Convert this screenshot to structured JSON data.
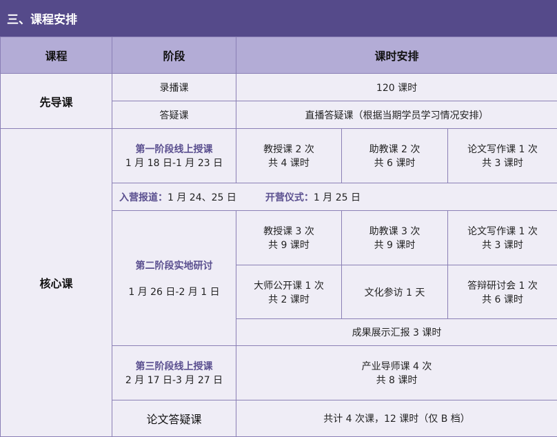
{
  "section_title": "三、课程安排",
  "headers": {
    "course": "课程",
    "stage": "阶段",
    "schedule": "课时安排"
  },
  "guide": {
    "course": "先导课",
    "rows": [
      {
        "stage": "录播课",
        "schedule": "120 课时"
      },
      {
        "stage": "答疑课",
        "schedule": "直播答疑课（根据当期学员学习情况安排）"
      }
    ]
  },
  "core": {
    "course": "核心课",
    "phase1": {
      "name": "第一阶段线上授课",
      "dates": "1 月 18 日-1 月 23 日",
      "cells": [
        {
          "line1": "教授课 2 次",
          "line2": "共 4 课时"
        },
        {
          "line1": "助教课  2 次",
          "line2": "共 6 课时"
        },
        {
          "line1": "论文写作课  1 次",
          "line2": "共 3 课时"
        }
      ]
    },
    "info_row": {
      "checkin_label": "入营报道：",
      "checkin_value": "1 月 24、25 日",
      "ceremony_label": "开营仪式：",
      "ceremony_value": "1 月 25 日"
    },
    "phase2": {
      "name": "第二阶段实地研讨",
      "dates": "1 月 26 日-2 月 1 日",
      "row1": [
        {
          "line1": "教授课 3 次",
          "line2": "共 9 课时"
        },
        {
          "line1": "助教课  3 次",
          "line2": "共 9 课时"
        },
        {
          "line1": "论文写作课 1 次",
          "line2": "共  3 课时"
        }
      ],
      "row2_left": {
        "line1": "大师公开课 1 次",
        "line2": "共 2 课时"
      },
      "row2_mid": "文化参访  1 天",
      "row2_right": {
        "line1": "答辩研讨会 1 次",
        "line2": "共 6 课时"
      },
      "summary": "成果展示汇报 3 课时"
    },
    "phase3": {
      "name": "第三阶段线上授课",
      "dates": "2 月 17 日-3 月 27 日",
      "line1": "产业导师课 4 次",
      "line2": "共  8 课时"
    }
  },
  "thesis": {
    "course": "论文答疑课",
    "schedule": "共计 4 次课，12 课时（仅 B 档）"
  }
}
